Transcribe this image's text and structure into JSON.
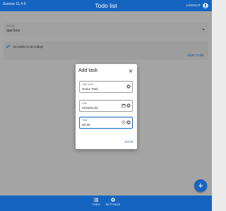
{
  "app_bar": {
    "version": "Scesve 11.4.0",
    "title": "Todo list",
    "logout": "LOGOUT"
  },
  "list_select": {
    "label": "Sort by",
    "value": "dueTime"
  },
  "tasks": {
    "empty_message": "No tasks to do today!",
    "add_task": "ADD TASK"
  },
  "dialog": {
    "title": "Add task",
    "fields": [
      {
        "label": "Task name",
        "value": "Some Task"
      },
      {
        "label": "Date",
        "value": "2020/01/31"
      },
      {
        "label": "Time",
        "value": "00:30"
      }
    ],
    "save": "SAVE"
  },
  "bottom_nav": {
    "items": [
      {
        "label": "TODO",
        "icon": "list-icon"
      },
      {
        "label": "SETTINGS",
        "icon": "gear-icon"
      }
    ]
  },
  "fab": {
    "label": "+",
    "icon": "plus-icon"
  },
  "colors": {
    "primary": "#1565c0",
    "background": "#e4e4e4",
    "dialog": "#ffffff"
  }
}
